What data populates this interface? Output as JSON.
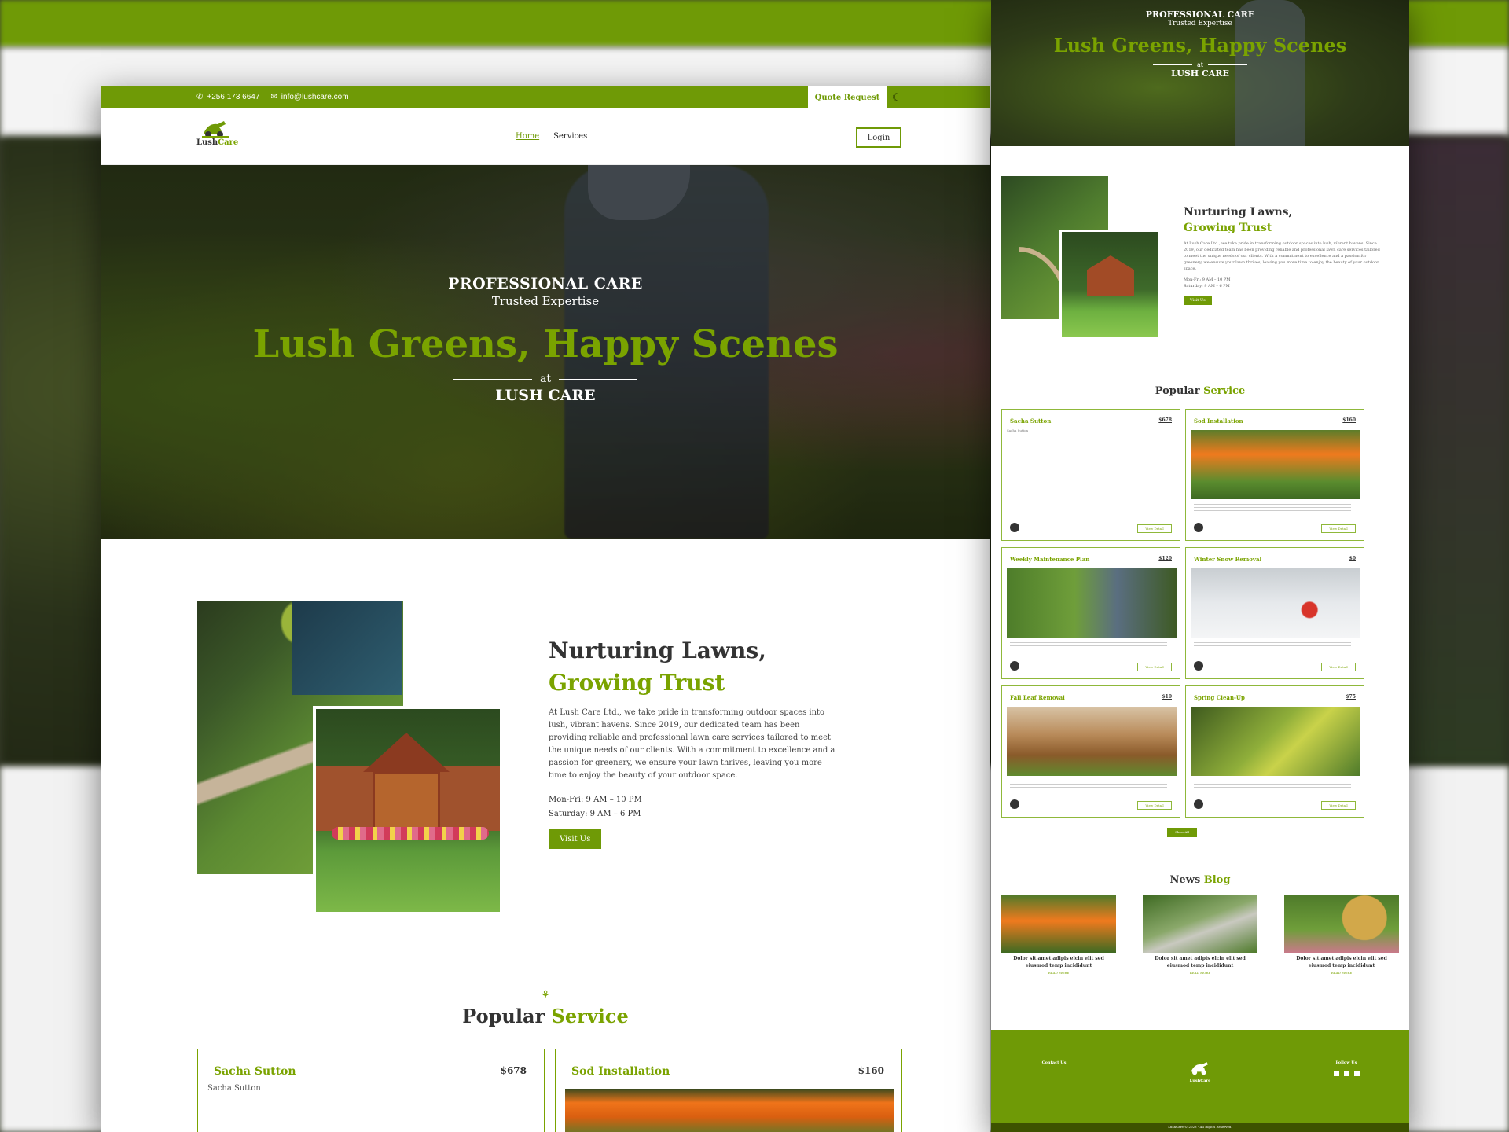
{
  "topbar": {
    "phone": "+256 173 6647",
    "email": "info@lushcare.com",
    "quote_label": "Quote Request",
    "theme_icon": "moon-icon"
  },
  "brand": {
    "name_part1": "Lush",
    "name_part2": "Care"
  },
  "nav": {
    "home": "Home",
    "services": "Services",
    "login": "Login"
  },
  "hero": {
    "line1": "PROFESSIONAL CARE",
    "line2": "Trusted Expertise",
    "headline": "Lush Greens, Happy Scenes",
    "at": "at",
    "brand": "LUSH CARE"
  },
  "about": {
    "title1": "Nurturing Lawns,",
    "title2": "Growing Trust",
    "paragraph": "At Lush Care Ltd., we take pride in transforming outdoor spaces into lush, vibrant havens. Since 2019, our dedicated team has been providing reliable and professional lawn care services tailored to meet the unique needs of our clients. With a commitment to excellence and a passion for greenery, we ensure your lawn thrives, leaving you more time to enjoy the beauty of your outdoor space.",
    "hours_weekday": "Mon-Fri: 9 AM – 10 PM",
    "hours_saturday": "Saturday: 9 AM – 6 PM",
    "visit_label": "Visit Us"
  },
  "popular": {
    "title_a": "Popular",
    "title_b": "Service"
  },
  "services": [
    {
      "name": "Sacha Sutton",
      "price": "$678",
      "alt": "Sacha Sutton"
    },
    {
      "name": "Sod Installation",
      "price": "$160"
    },
    {
      "name": "Weekly Maintenance Plan",
      "price": "$120"
    },
    {
      "name": "Winter Snow Removal",
      "price": "$0"
    },
    {
      "name": "Fall Leaf Removal",
      "price": "$10"
    },
    {
      "name": "Spring Clean-Up",
      "price": "$75"
    }
  ],
  "right": {
    "view_detail": "View Detail",
    "show_all": "Show All",
    "news_a": "News",
    "news_b": "Blog",
    "blog_title": "Dolor sit amet adipis elcin elit sed eiusmod temp incididunt",
    "read_more": "READ MORE",
    "footer_contact": "Contact Us",
    "footer_follow": "Follow Us",
    "copyright": "LushCare © 2023 - All Rights Reserved."
  },
  "colors": {
    "brand_green": "#6f9a06",
    "accent_green": "#7aa300"
  }
}
